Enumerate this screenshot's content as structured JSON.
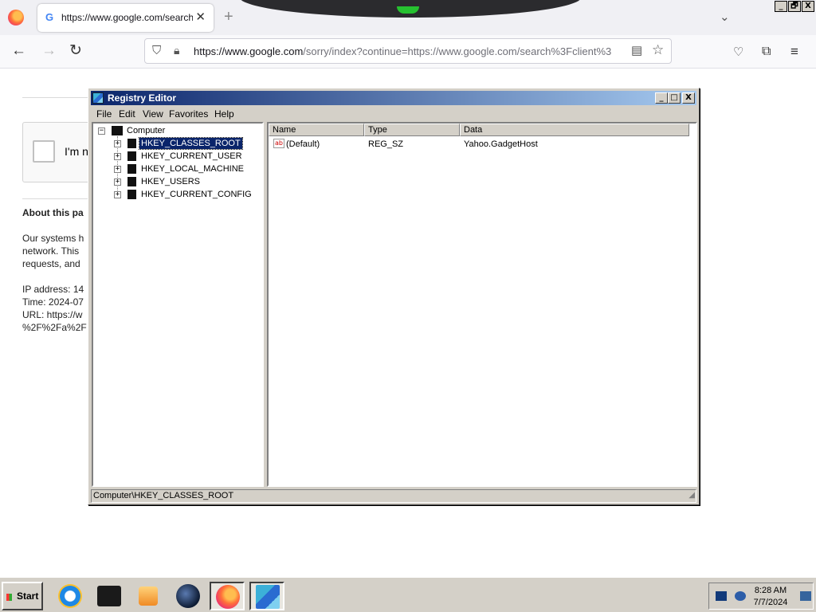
{
  "browser": {
    "tab_title": "https://www.google.com/search?c",
    "tab_favicon": "G",
    "new_tab_label": "+",
    "tab_list_glyph": "⌄",
    "window_controls": [
      "_",
      "🗗",
      "X"
    ],
    "url_host": "https://www.google.com",
    "url_rest": "/sorry/index?continue=https://www.google.com/search%3Fclient%3",
    "nav": {
      "back": "←",
      "forward": "→",
      "reload": "↻"
    },
    "toolbar_icons": [
      "pocket-icon",
      "extensions-icon",
      "menu-icon"
    ]
  },
  "page": {
    "captcha_label": "I'm n",
    "about_title": "About this pa",
    "body_lines": [
      "Our systems h",
      "network. This",
      "requests, and"
    ],
    "ip_line": "IP address: 14",
    "time_line": "Time: 2024-07",
    "url_line": "URL: https://w",
    "url_line2": "%2F%2Fa%2F"
  },
  "regedit": {
    "title": "Registry Editor",
    "title_buttons": [
      "_",
      "□",
      "X"
    ],
    "menu": [
      "File",
      "Edit",
      "View",
      "Favorites",
      "Help"
    ],
    "tree": {
      "root": "Computer",
      "keys": [
        "HKEY_CLASSES_ROOT",
        "HKEY_CURRENT_USER",
        "HKEY_LOCAL_MACHINE",
        "HKEY_USERS",
        "HKEY_CURRENT_CONFIG"
      ],
      "selected": "HKEY_CLASSES_ROOT"
    },
    "columns": [
      "Name",
      "Type",
      "Data"
    ],
    "values": [
      {
        "name": "(Default)",
        "type": "REG_SZ",
        "data": "Yahoo.GadgetHost"
      }
    ],
    "status": "Computer\\HKEY_CLASSES_ROOT"
  },
  "taskbar": {
    "start_label": "Start",
    "apps": [
      "internet-explorer-icon",
      "terminal-icon",
      "media-player-icon",
      "globe-icon",
      "firefox-icon",
      "regedit-icon"
    ],
    "time": "8:28 AM",
    "date": "7/7/2024"
  }
}
